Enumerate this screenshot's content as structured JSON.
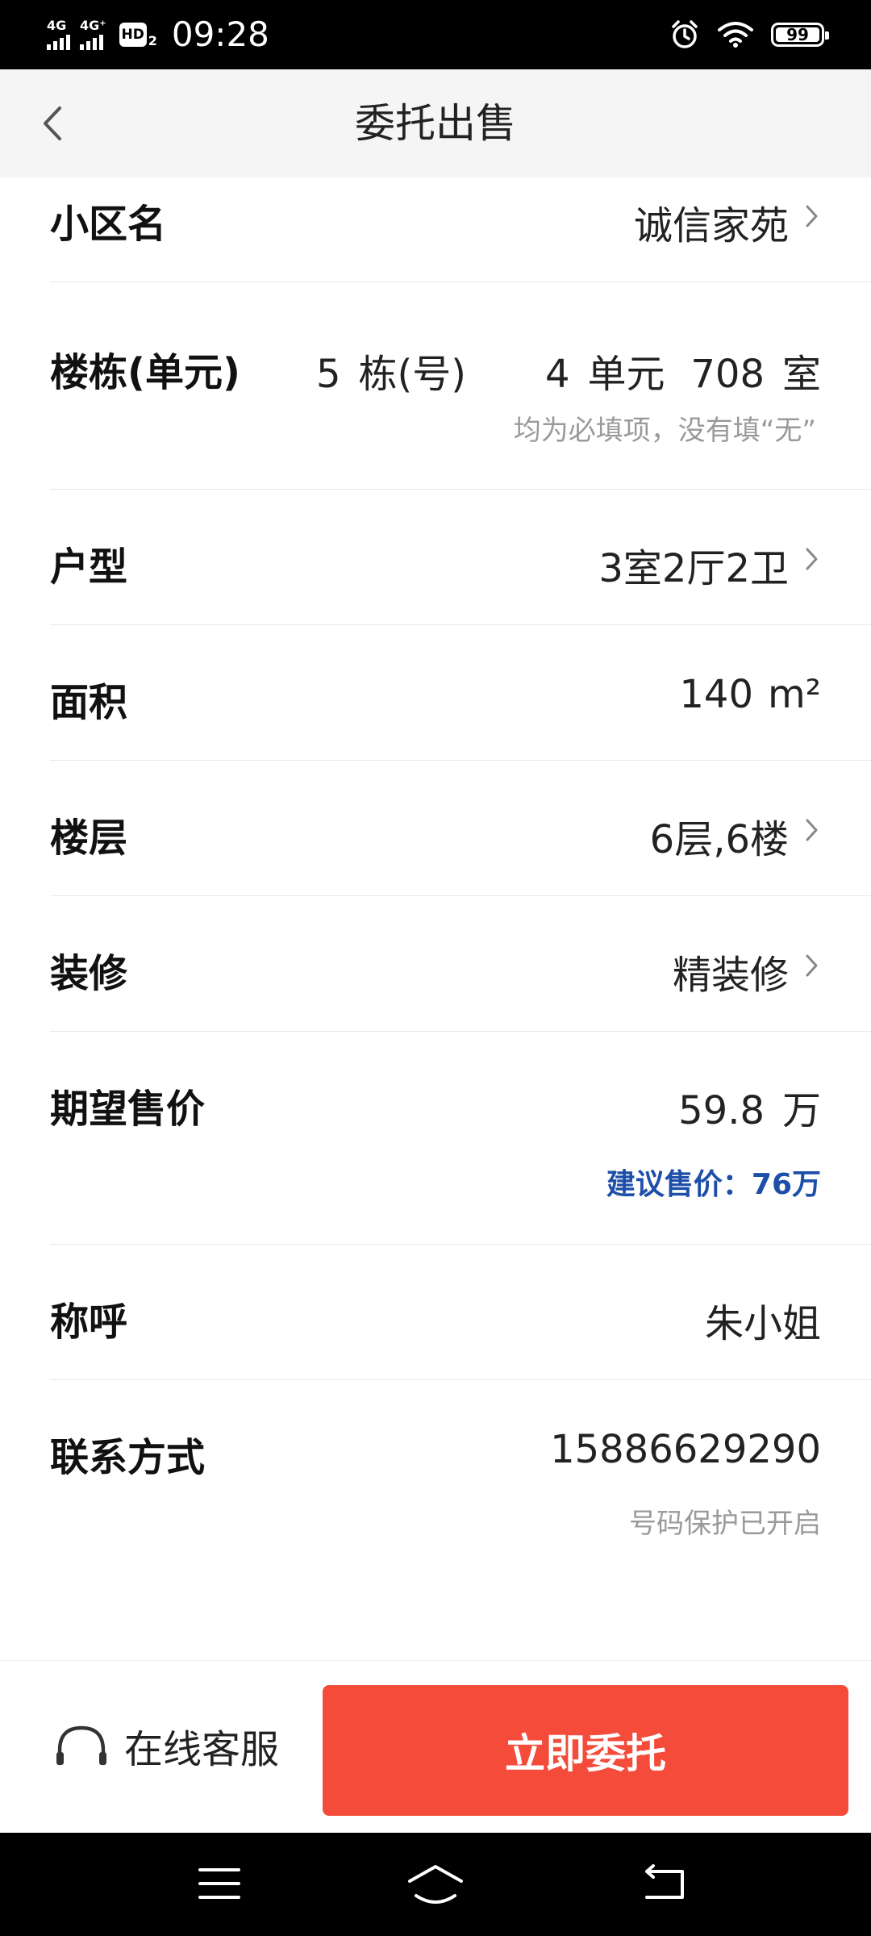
{
  "status_bar": {
    "signal1_label": "4G",
    "signal2_label": "4G⁺",
    "hd_label": "HD",
    "hd_sub": "2",
    "time": "09:28",
    "battery": "99"
  },
  "header": {
    "title": "委托出售"
  },
  "form": {
    "community": {
      "label": "小区名",
      "value": "诚信家苑"
    },
    "building": {
      "label": "楼栋(单元)",
      "building_no": "5",
      "building_unit": "栋(号)",
      "unit_no": "4",
      "unit_unit": "单元",
      "room_no": "708",
      "room_unit": "室",
      "hint": "均为必填项，没有填“无”"
    },
    "layout": {
      "label": "户型",
      "value": "3室2厅2卫"
    },
    "area": {
      "label": "面积",
      "value": "140",
      "unit": "m²"
    },
    "floor": {
      "label": "楼层",
      "value": "6层,6楼"
    },
    "decoration": {
      "label": "装修",
      "value": "精装修"
    },
    "price": {
      "label": "期望售价",
      "value": "59.8",
      "unit": "万",
      "suggest": "建议售价：76万"
    },
    "name": {
      "label": "称呼",
      "value": "朱小姐"
    },
    "contact": {
      "label": "联系方式",
      "value": "15886629290",
      "hint": "号码保护已开启"
    }
  },
  "actions": {
    "service_label": "在线客服",
    "entrust_label": "立即委托"
  },
  "colors": {
    "accent": "#f44b3a",
    "suggest": "#1e4fa8",
    "header_bg": "#f5f5f5"
  }
}
